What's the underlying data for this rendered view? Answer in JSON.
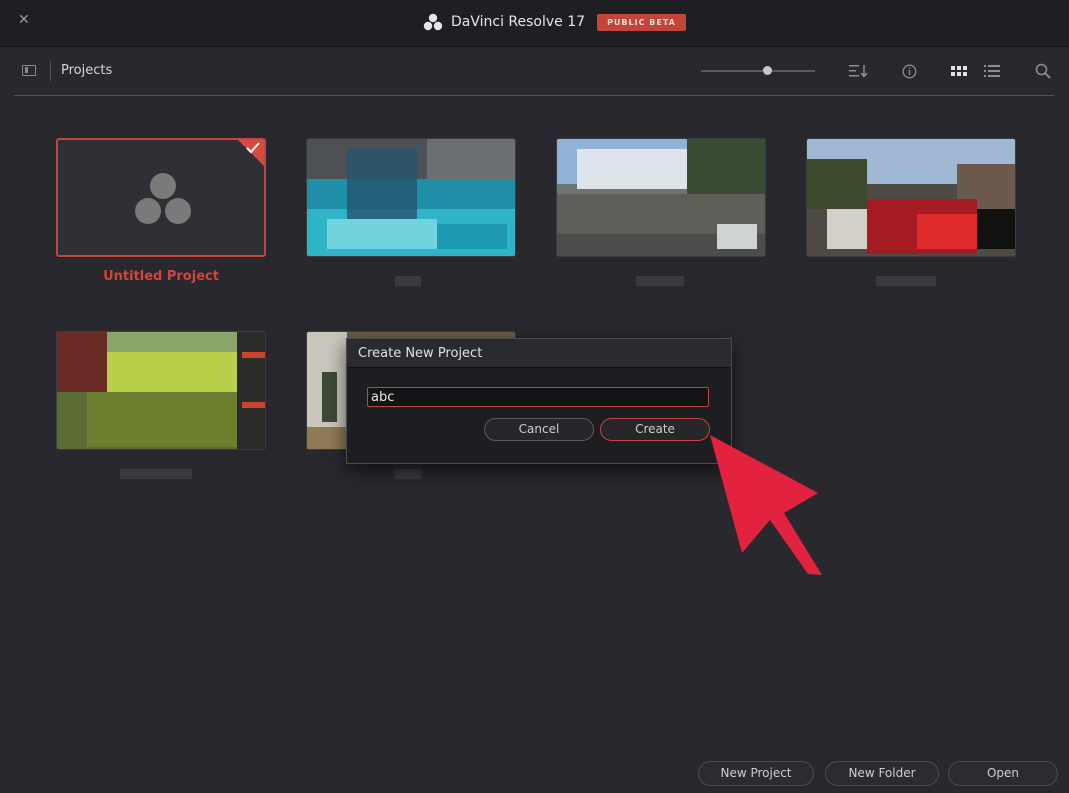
{
  "app": {
    "title": "DaVinci Resolve 17",
    "badge": "PUBLIC BETA"
  },
  "toolbar": {
    "title": "Projects",
    "icons": [
      "sidebar-toggle-icon",
      "sort-icon",
      "info-icon",
      "grid-view-icon",
      "list-view-icon",
      "search-icon"
    ]
  },
  "projects": [
    {
      "name": "Untitled Project",
      "selected": true
    },
    {
      "name": "",
      "selected": false
    },
    {
      "name": "",
      "selected": false
    },
    {
      "name": "",
      "selected": false
    },
    {
      "name": "",
      "selected": false
    },
    {
      "name": "",
      "selected": false
    }
  ],
  "dialog": {
    "title": "Create New Project",
    "input_value": "abc",
    "cancel_label": "Cancel",
    "create_label": "Create"
  },
  "footer": {
    "new_project": "New Project",
    "new_folder": "New Folder",
    "open": "Open"
  },
  "colors": {
    "accent": "#c0463f",
    "background": "#28282e",
    "arrow": "#e2223f"
  }
}
